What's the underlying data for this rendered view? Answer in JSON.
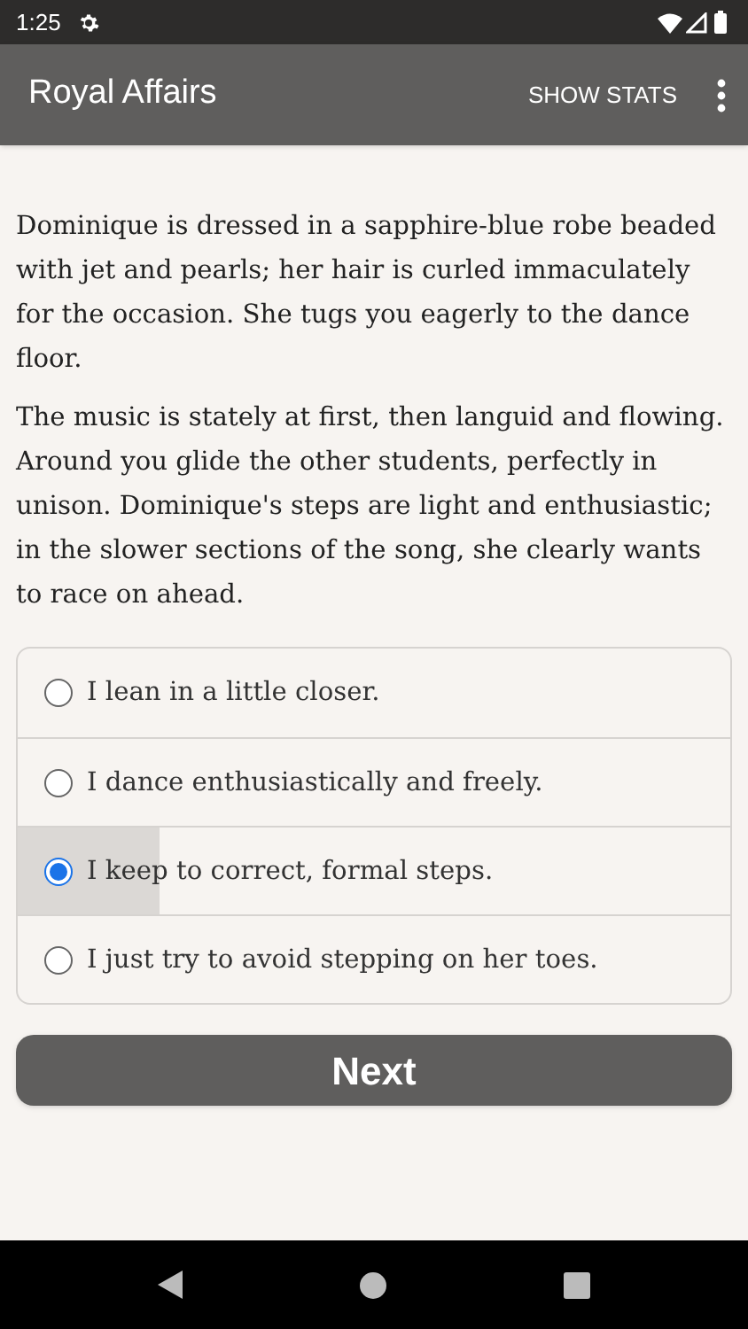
{
  "status_bar": {
    "time": "1:25"
  },
  "app_bar": {
    "title": "Royal Affairs",
    "action": "SHOW STATS"
  },
  "paragraphs": [
    "Dominique is dressed in a sapphire-blue robe beaded with jet and pearls; her hair is curled immaculately for the occasion. She tugs you eagerly to the dance floor.",
    "The music is stately at first, then languid and flowing. Around you glide the other students, perfectly in unison. Dominique's steps are light and enthusiastic; in the slower sections of the song, she clearly wants to race on ahead."
  ],
  "choices": [
    {
      "label": "I lean in a little closer.",
      "selected": false
    },
    {
      "label": "I dance enthusiastically and freely.",
      "selected": false
    },
    {
      "label": "I keep to correct, formal steps.",
      "selected": true
    },
    {
      "label": "I just try to avoid stepping on her toes.",
      "selected": false
    }
  ],
  "next_button": "Next"
}
